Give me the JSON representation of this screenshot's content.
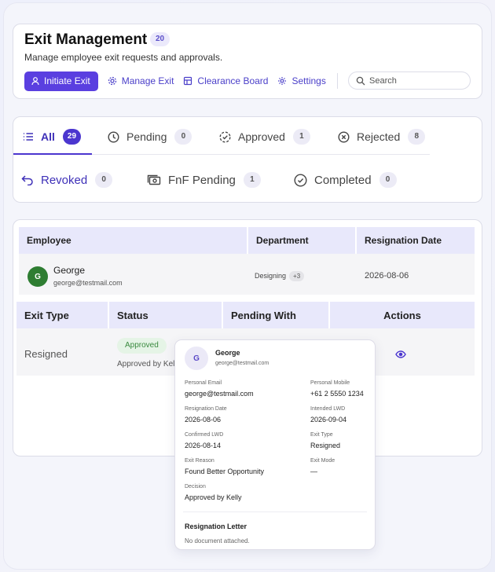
{
  "header": {
    "title": "Exit Management",
    "count": "20",
    "subtitle": "Manage employee exit requests and approvals.",
    "initiate_label": "Initiate Exit",
    "manage_label": "Manage Exit",
    "clearance_label": "Clearance Board",
    "settings_label": "Settings",
    "search_placeholder": "Search"
  },
  "tabs": [
    {
      "label": "All",
      "count": "29",
      "icon": "list-icon"
    },
    {
      "label": "Pending",
      "count": "0",
      "icon": "clock-icon"
    },
    {
      "label": "Approved",
      "count": "1",
      "icon": "check-circle-dashed-icon"
    },
    {
      "label": "Rejected",
      "count": "8",
      "icon": "x-circle-icon"
    },
    {
      "label": "Revoked",
      "count": "0",
      "icon": "undo-arrow-icon"
    },
    {
      "label": "FnF Pending",
      "count": "1",
      "icon": "money-icon"
    },
    {
      "label": "Completed",
      "count": "0",
      "icon": "check-circle-icon"
    }
  ],
  "table": {
    "headers1": [
      "Employee",
      "Department",
      "Resignation Date"
    ],
    "headers2": [
      "Exit Type",
      "Status",
      "Pending With",
      "Actions"
    ],
    "row": {
      "avatar": "G",
      "name": "George",
      "email": "george@testmail.com",
      "department": "Designing",
      "dept_more": "+3",
      "resignation_date": "2026-08-06",
      "exit_type": "Resigned",
      "status": "Approved",
      "status_note": "Approved by Kel"
    }
  },
  "popover": {
    "avatar": "G",
    "name": "George",
    "email": "george@testmail.com",
    "fields": {
      "personal_email_label": "Personal Email",
      "personal_email": "george@testmail.com",
      "personal_mobile_label": "Personal Mobile",
      "personal_mobile": "+61 2 5550 1234",
      "resignation_date_label": "Resignation Date",
      "resignation_date": "2026-08-06",
      "intended_lwd_label": "Intended LWD",
      "intended_lwd": "2026-09-04",
      "confirmed_lwd_label": "Confirmed LWD",
      "confirmed_lwd": "2026-08-14",
      "exit_type_label": "Exit Type",
      "exit_type": "Resigned",
      "exit_reason_label": "Exit Reason",
      "exit_reason": "Found Better Opportunity",
      "exit_mode_label": "Exit Mode",
      "exit_mode": "—",
      "decision_label": "Decision",
      "decision": "Approved by Kelly"
    },
    "letter_title": "Resignation Letter",
    "letter_note": "No document attached."
  },
  "colors": {
    "accent": "#5a3fe0",
    "approved_bg": "#e5f4e6",
    "approved_text": "#3a8a3f"
  }
}
